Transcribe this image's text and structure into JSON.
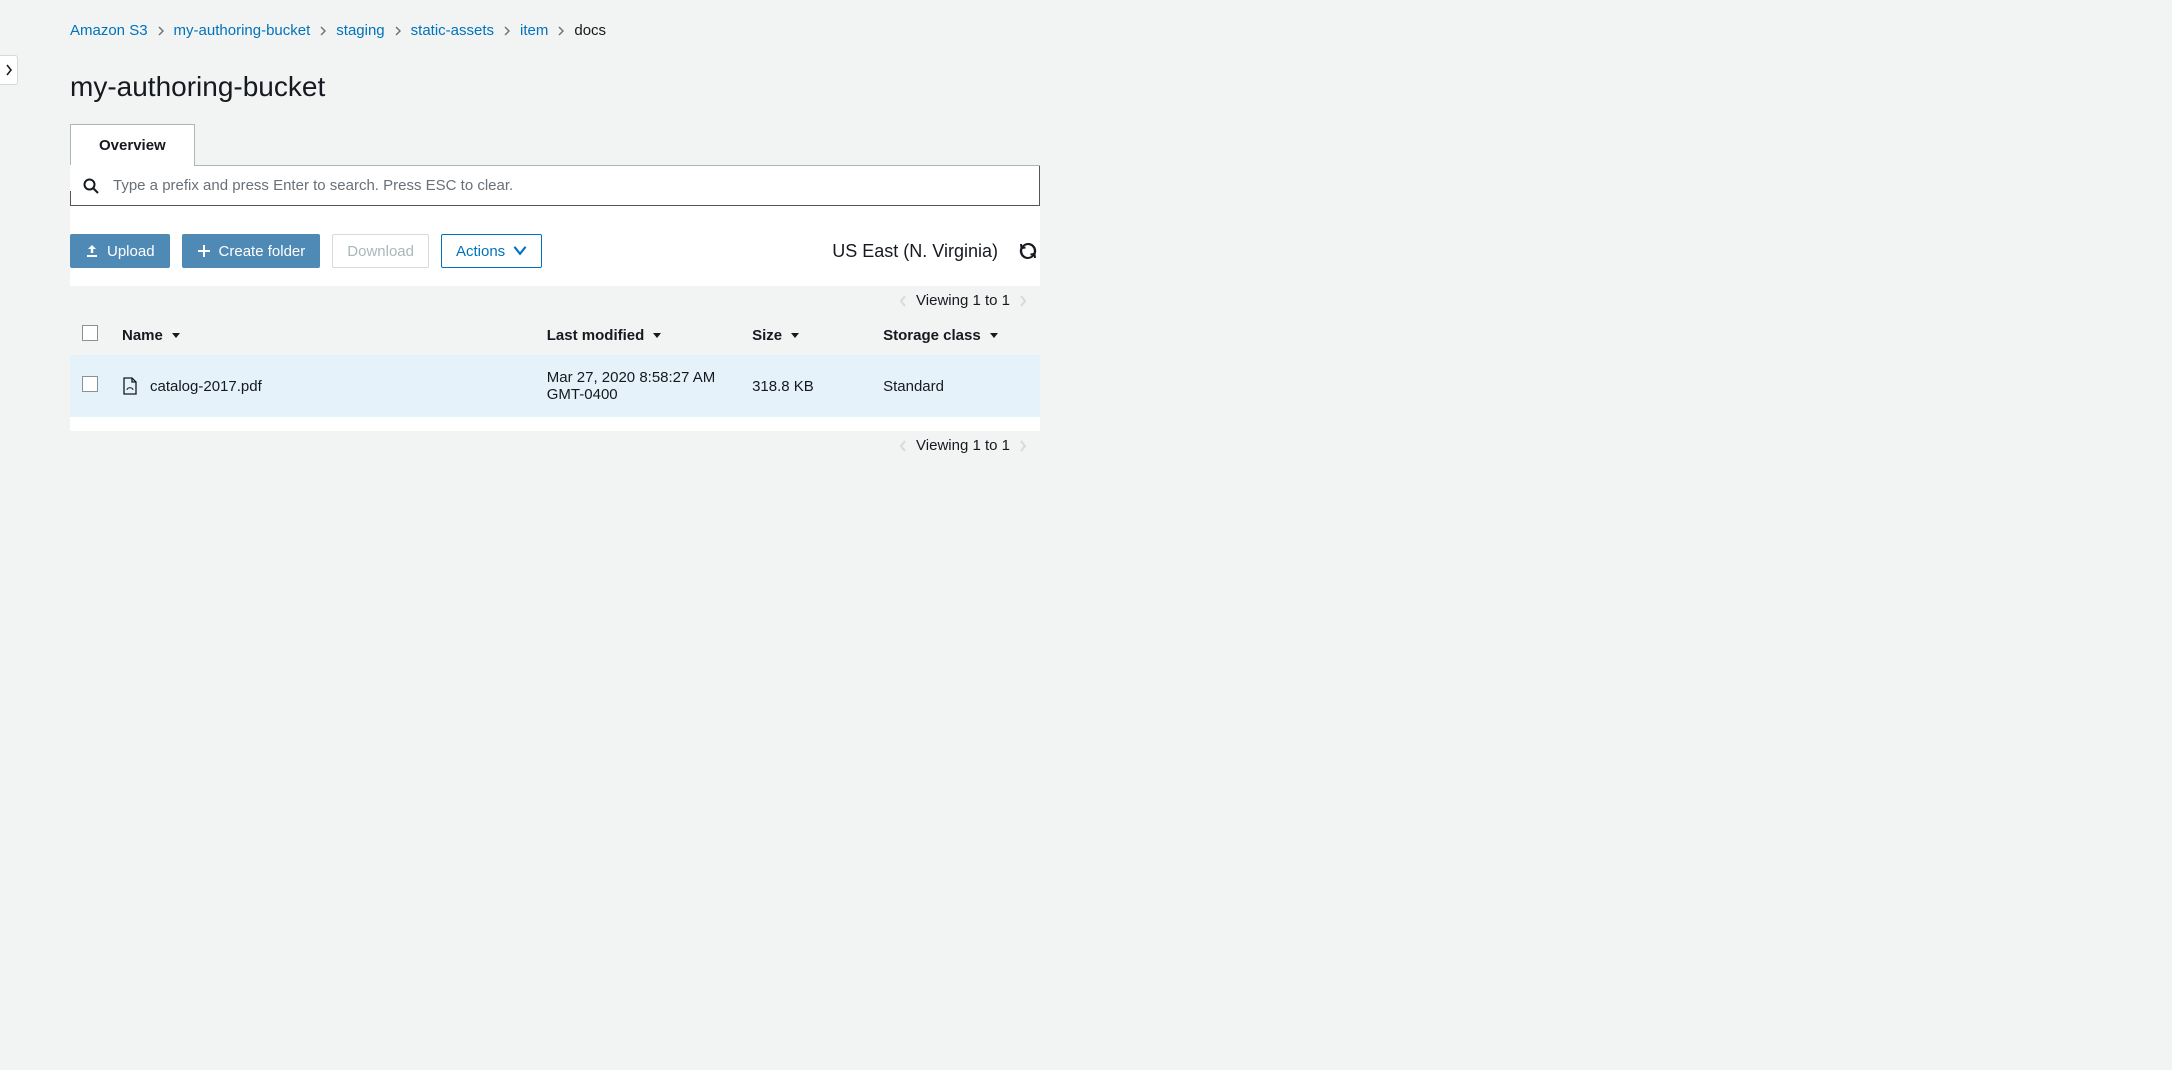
{
  "breadcrumb": {
    "items": [
      {
        "label": "Amazon S3",
        "link": true
      },
      {
        "label": "my-authoring-bucket",
        "link": true
      },
      {
        "label": "staging",
        "link": true
      },
      {
        "label": "static-assets",
        "link": true
      },
      {
        "label": "item",
        "link": true
      },
      {
        "label": "docs",
        "link": false
      }
    ]
  },
  "page_title": "my-authoring-bucket",
  "tabs": {
    "overview": "Overview"
  },
  "search": {
    "placeholder": "Type a prefix and press Enter to search. Press ESC to clear."
  },
  "toolbar": {
    "upload": "Upload",
    "create_folder": "Create folder",
    "download": "Download",
    "actions": "Actions"
  },
  "region": "US East (N. Virginia)",
  "paging": {
    "top": "Viewing 1 to 1",
    "bottom": "Viewing 1 to 1"
  },
  "columns": {
    "name": "Name",
    "last_modified": "Last modified",
    "size": "Size",
    "storage_class": "Storage class"
  },
  "rows": [
    {
      "name": "catalog-2017.pdf",
      "last_modified": "Mar 27, 2020 8:58:27 AM GMT-0400",
      "size": "318.8 KB",
      "storage_class": "Standard"
    }
  ]
}
